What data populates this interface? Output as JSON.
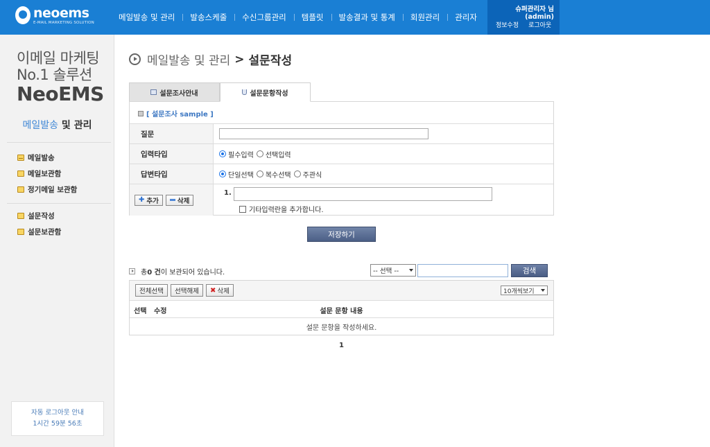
{
  "header": {
    "logo_text": "neoems",
    "logo_sub": "E-MAIL MARKETING SOLUTION",
    "nav": [
      "메일발송 및 관리",
      "발송스케줄",
      "수신그룹관리",
      "템플릿",
      "발송결과 및 통계",
      "회원관리",
      "관리자"
    ],
    "user_name": "슈퍼관리자 님",
    "user_id": "(admin)",
    "link_edit": "정보수정",
    "link_logout": "로그아웃",
    "colors": {
      "topbar": "#1a7fd4",
      "userbox": "#0c64b8"
    }
  },
  "sidebar": {
    "slogan_line1": "이메일 마케팅",
    "slogan_line2": "No.1 솔루션",
    "slogan_line3": "NeoEMS",
    "title_accent": "메일발송",
    "title_rest": " 및 관리",
    "menu_group1": [
      {
        "label": "메일발송",
        "icon": "envelope-icon"
      },
      {
        "label": "메일보관함",
        "icon": "mailbox-icon"
      },
      {
        "label": "정기메일 보관함",
        "icon": "scheduled-mail-icon"
      }
    ],
    "menu_group2": [
      {
        "label": "설문작성",
        "icon": "survey-write-icon"
      },
      {
        "label": "설문보관함",
        "icon": "survey-box-icon"
      }
    ],
    "logout_title": "자동 로그아웃 안내",
    "logout_time": "1시간 59분 56초"
  },
  "page": {
    "breadcrumb_parent": "메일발송 및 관리",
    "breadcrumb_sep": ">",
    "breadcrumb_current": "설문작성"
  },
  "tabs": [
    {
      "label": "설문조사안내",
      "active": false
    },
    {
      "label": "설문문항작성",
      "active": true
    }
  ],
  "form": {
    "survey_title": "[ 설문조사 sample ]",
    "question_label": "질문",
    "question_value": "",
    "input_type_label": "입력타입",
    "input_type_options": [
      "필수입력",
      "선택입력"
    ],
    "answer_type_label": "답변타입",
    "answer_type_options": [
      "단일선택",
      "복수선택",
      "주관식"
    ],
    "add_label": "추가",
    "delete_label": "삭제",
    "answer_number": "1.",
    "answer_value": "",
    "etc_label": "기타입력란을 추가합니다."
  },
  "save_label": "저장하기",
  "list": {
    "count_prefix": "총 ",
    "count": "0 건",
    "count_suffix": "이 보관되어 있습니다.",
    "search_select": "-- 선택 --",
    "search_value": "",
    "search_label": "검색",
    "select_all": "전체선택",
    "deselect": "선택해제",
    "delete": "삭제",
    "per_page": "10개씩보기",
    "col_select": "선택",
    "col_edit": "수정",
    "col_content": "설문 문항 내용",
    "empty_message": "설문 문항을 작성하세요.",
    "page": "1"
  }
}
